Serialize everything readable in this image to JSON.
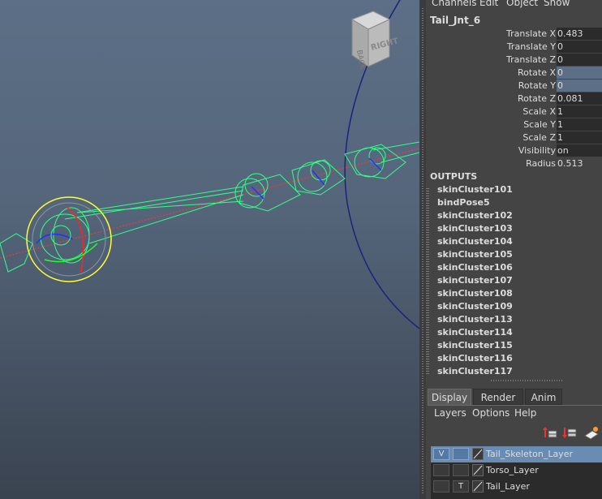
{
  "channel_box": {
    "menu": [
      "Channels",
      "Edit",
      "Object",
      "Show"
    ],
    "node_name": "Tail_Jnt_6",
    "attributes": [
      {
        "label": "Translate X",
        "value": "0.483",
        "state": "normal"
      },
      {
        "label": "Translate Y",
        "value": "0",
        "state": "normal"
      },
      {
        "label": "Translate Z",
        "value": "0",
        "state": "normal"
      },
      {
        "label": "Rotate X",
        "value": "0",
        "state": "selected"
      },
      {
        "label": "Rotate Y",
        "value": "0",
        "state": "selected"
      },
      {
        "label": "Rotate Z",
        "value": "0.081",
        "state": "normal"
      },
      {
        "label": "Scale X",
        "value": "1",
        "state": "normal"
      },
      {
        "label": "Scale Y",
        "value": "1",
        "state": "normal"
      },
      {
        "label": "Scale Z",
        "value": "1",
        "state": "normal"
      },
      {
        "label": "Visibility",
        "value": "on",
        "state": "normal"
      },
      {
        "label": "Radius",
        "value": "0.513",
        "state": "plain"
      }
    ],
    "outputs_title": "OUTPUTS",
    "outputs": [
      "skinCluster101",
      "bindPose5",
      "skinCluster102",
      "skinCluster103",
      "skinCluster104",
      "skinCluster105",
      "skinCluster106",
      "skinCluster107",
      "skinCluster108",
      "skinCluster109",
      "skinCluster113",
      "skinCluster114",
      "skinCluster115",
      "skinCluster116",
      "skinCluster117"
    ]
  },
  "layer_panel": {
    "tabs": [
      "Display",
      "Render",
      "Anim"
    ],
    "active_tab": "Display",
    "menu": [
      "Layers",
      "Options",
      "Help"
    ],
    "tool_icons": [
      "new-layer-from-selected-icon",
      "new-empty-layer-icon",
      "layer-options-icon"
    ],
    "layers": [
      {
        "visibility": "V",
        "type": "",
        "name": "Tail_Skeleton_Layer",
        "selected": true
      },
      {
        "visibility": "",
        "type": "",
        "name": "Torso_Layer",
        "selected": false
      },
      {
        "visibility": "",
        "type": "T",
        "name": "Tail_Layer",
        "selected": false
      }
    ]
  },
  "viewport": {
    "view_cube_label": "RIGHT",
    "colors": {
      "joint_wire": "#33ff88",
      "selected_ring": "#ffff33",
      "rotate_x": "#ff2222",
      "rotate_y": "#22ff22",
      "rotate_z": "#2233ff",
      "ik_line": "#ff3333",
      "big_arc": "#1a237e"
    }
  }
}
